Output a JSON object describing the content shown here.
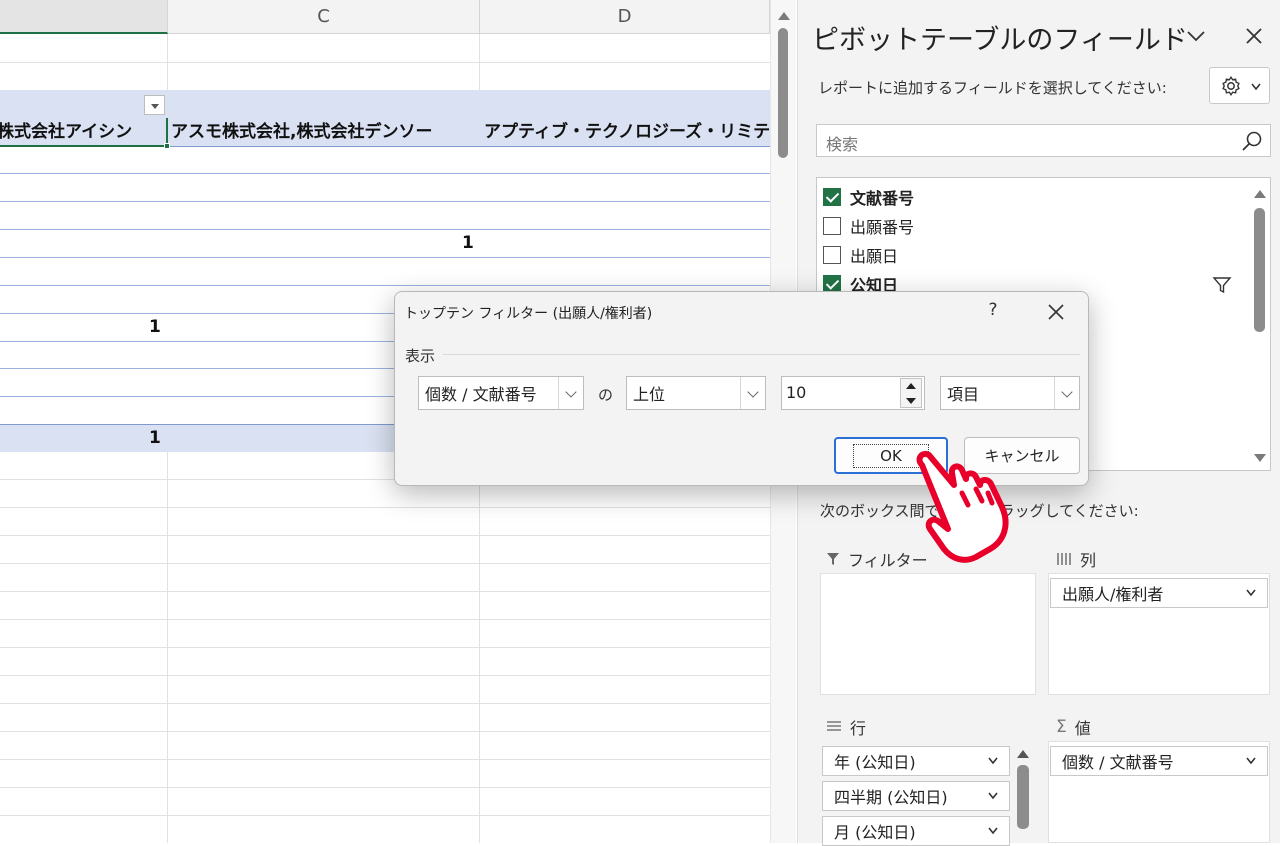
{
  "sheet": {
    "columns": [
      "C",
      "D"
    ],
    "header_cells": [
      "株式会社アイシン",
      "アスモ株式会社,株式会社デンソー",
      "アプティブ・テクノロジーズ・リミテッド"
    ],
    "values": {
      "d_row": "1",
      "b_row1": "1",
      "b_total": "1"
    }
  },
  "pane": {
    "title": "ピボットテーブルのフィールド",
    "instruction": "レポートに追加するフィールドを選択してください:",
    "search_placeholder": "検索",
    "fields": [
      {
        "label": "文献番号",
        "checked": true
      },
      {
        "label": "出願番号",
        "checked": false
      },
      {
        "label": "出願日",
        "checked": false
      },
      {
        "label": "公知日",
        "checked": true
      }
    ],
    "drag_instruction_left": "次のボックス間で",
    "drag_instruction_right": "ラッグしてください:",
    "areas": {
      "filter": "フィルター",
      "columns": "列",
      "rows": "行",
      "values": "値"
    },
    "column_items": [
      "出願人/権利者"
    ],
    "row_items": [
      "年 (公知日)",
      "四半期 (公知日)",
      "月 (公知日)"
    ],
    "value_items": [
      "個数 / 文献番号"
    ]
  },
  "dialog": {
    "title": "トップテン フィルター (出願人/権利者)",
    "help": "?",
    "group_label": "表示",
    "field_combo": "個数 / 文献番号",
    "of_label": "の",
    "order_combo": "上位",
    "count_value": "10",
    "unit_combo": "項目",
    "ok_label": "OK",
    "cancel_label": "キャンセル"
  },
  "colors": {
    "accent_green": "#217346",
    "band_blue": "#d9e1f2",
    "focus_blue": "#2a6fd3",
    "hand_red": "#e8002b"
  }
}
